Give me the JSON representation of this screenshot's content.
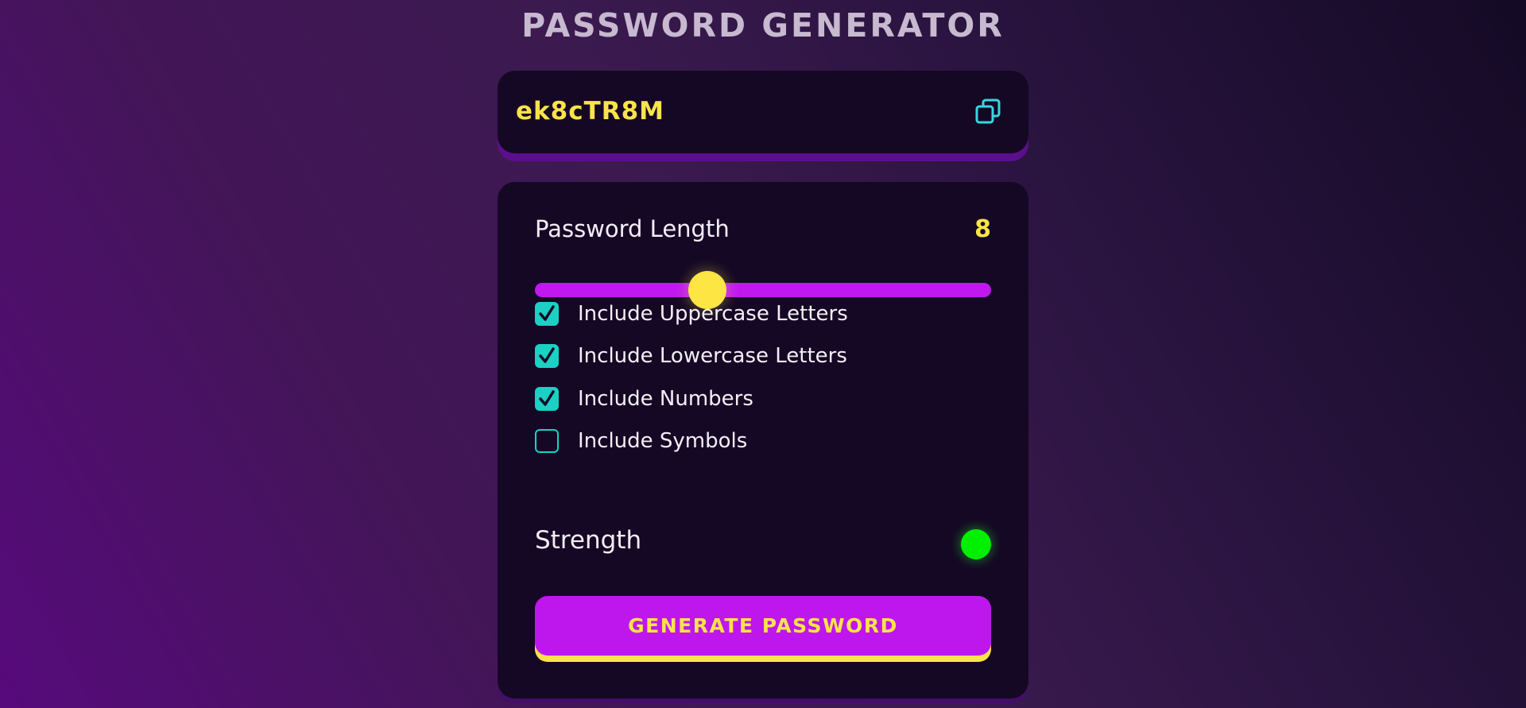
{
  "app": {
    "title": "PASSWORD GENERATOR"
  },
  "display": {
    "password": "ek8cTR8M",
    "copy_icon": "copy-icon"
  },
  "settings": {
    "length_label": "Password Length",
    "length_value": "8",
    "slider": {
      "value": 8,
      "fraction": 0.378
    },
    "options": [
      {
        "label": "Include Uppercase Letters",
        "checked": true
      },
      {
        "label": "Include Lowercase Letters",
        "checked": true
      },
      {
        "label": "Include Numbers",
        "checked": true
      },
      {
        "label": "Include Symbols",
        "checked": false
      }
    ],
    "strength_label": "Strength",
    "strength_color": "#00f000",
    "generate_label": "GENERATE PASSWORD"
  },
  "colors": {
    "accent_yellow": "#fbe34a",
    "accent_purple": "#c118f0",
    "accent_teal": "#1ad1c4",
    "panel_bg": "#150825"
  }
}
